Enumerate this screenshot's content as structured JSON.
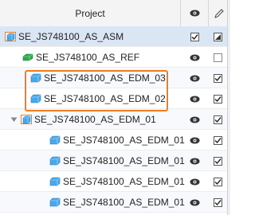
{
  "header": {
    "project_label": "Project",
    "visibility_icon": "eye-icon",
    "sync_icon": "pencil-icon"
  },
  "rows": [
    {
      "name": "SE_JS748100_AS_ASM",
      "icon": "assembly-cube-icon",
      "visible": false,
      "checked": true
    },
    {
      "name": "SE_JS748100_AS_REF",
      "icon": "reference-cube-icon",
      "visible": true,
      "checked": false
    },
    {
      "name": "SE_JS748100_AS_EDM_03",
      "icon": "cube-icon",
      "visible": true,
      "checked": true
    },
    {
      "name": "SE_JS748100_AS_EDM_02",
      "icon": "cube-icon",
      "visible": true,
      "checked": true
    },
    {
      "name": "SE_JS748100_AS_EDM_01",
      "icon": "cube-icon",
      "visible": true,
      "checked": true,
      "expanded": true
    },
    {
      "name": "SE_JS748100_AS_EDM_01",
      "icon": "cube-icon",
      "visible": true,
      "checked": true
    },
    {
      "name": "SE_JS748100_AS_EDM_01",
      "icon": "cube-icon",
      "visible": true,
      "checked": true
    },
    {
      "name": "SE_JS748100_AS_EDM_01",
      "icon": "cube-icon",
      "visible": true,
      "checked": true
    },
    {
      "name": "SE_JS748100_AS_EDM_01",
      "icon": "cube-icon",
      "visible": true,
      "checked": true
    }
  ],
  "colors": {
    "highlight": "#ef7d1f",
    "selected_row": "#dbe6f5",
    "cube_blue": "#4aa8e8",
    "cube_green": "#2fa84f"
  }
}
